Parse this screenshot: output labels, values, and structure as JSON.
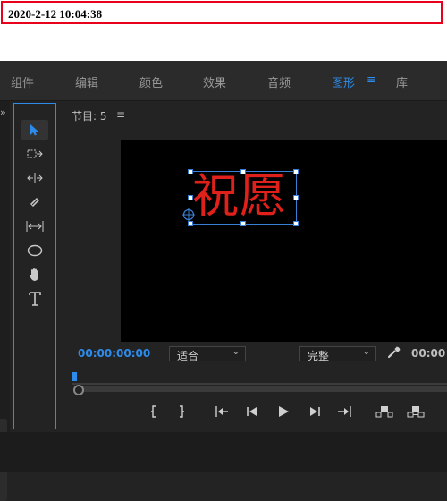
{
  "header": {
    "timestamp": "2020-2-12 10:04:38"
  },
  "workspace": {
    "tabs": [
      {
        "label": "组件"
      },
      {
        "label": "编辑"
      },
      {
        "label": "颜色"
      },
      {
        "label": "效果"
      },
      {
        "label": "音频"
      },
      {
        "label": "图形",
        "active": true
      },
      {
        "label": "库"
      }
    ],
    "menu_icon": "≡"
  },
  "program_monitor": {
    "title": "节目: 5",
    "menu_icon": "≡",
    "title_text": "祝愿",
    "title_color": "#e0211b",
    "timecode": "00:00:00:00",
    "timecode_right": "00:00",
    "fit_select": {
      "value": "适合"
    },
    "quality_select": {
      "value": "完整"
    }
  },
  "tools": [
    {
      "name": "selection-tool-icon",
      "glyph": "➤"
    },
    {
      "name": "track-select-tool-icon",
      "glyph": "⇢"
    },
    {
      "name": "ripple-edit-tool-icon",
      "glyph": "⟺"
    },
    {
      "name": "razor-tool-icon",
      "glyph": "◆"
    },
    {
      "name": "slip-tool-icon",
      "glyph": "↔"
    },
    {
      "name": "ellipse-tool-icon",
      "glyph": "◯"
    },
    {
      "name": "hand-tool-icon",
      "glyph": "✋"
    },
    {
      "name": "type-tool-icon",
      "glyph": "T"
    }
  ],
  "colors": {
    "accent": "#2d8ceb",
    "alert": "#e8001c"
  }
}
